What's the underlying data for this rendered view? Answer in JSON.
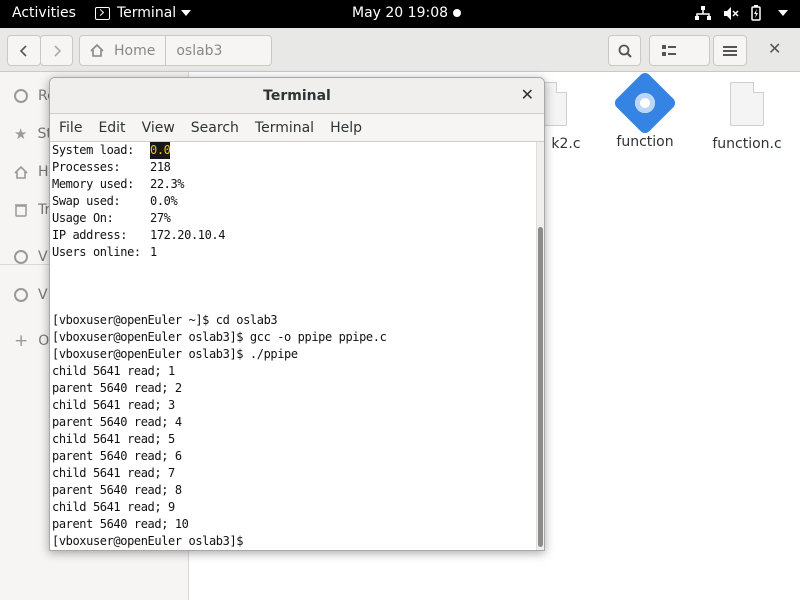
{
  "topbar": {
    "activities": "Activities",
    "app_name": "Terminal",
    "clock": "May 20  19:08"
  },
  "files": {
    "path": [
      "Home",
      "oslab3"
    ],
    "sidebar": [
      "Re",
      "St",
      "H",
      "Tr",
      "VI",
      "VI",
      "O"
    ],
    "items": [
      {
        "name": "k2.c",
        "icon": "document-icon"
      },
      {
        "name": "function",
        "icon": "executable-icon"
      },
      {
        "name": "function.c",
        "icon": "document-icon"
      }
    ]
  },
  "terminal": {
    "title": "Terminal",
    "menu": [
      "File",
      "Edit",
      "View",
      "Search",
      "Terminal",
      "Help"
    ],
    "sysinfo": [
      {
        "label": "System load:",
        "value": "0.0",
        "highlight": true
      },
      {
        "label": "Processes:",
        "value": "218"
      },
      {
        "label": "Memory used:",
        "value": "22.3%"
      },
      {
        "label": "Swap used:",
        "value": "0.0%"
      },
      {
        "label": "Usage On:",
        "value": "27%"
      },
      {
        "label": "IP address:",
        "value": "172.20.10.4"
      },
      {
        "label": "Users online:",
        "value": "1"
      }
    ],
    "lines": [
      "[vboxuser@openEuler ~]$ cd oslab3",
      "[vboxuser@openEuler oslab3]$ gcc -o ppipe ppipe.c",
      "[vboxuser@openEuler oslab3]$ ./ppipe",
      "child 5641 read; 1",
      "parent 5640 read; 2",
      "child 5641 read; 3",
      "parent 5640 read; 4",
      "child 5641 read; 5",
      "parent 5640 read; 6",
      "child 5641 read; 7",
      "parent 5640 read; 8",
      "child 5641 read; 9",
      "parent 5640 read; 10",
      "[vboxuser@openEuler oslab3]$"
    ]
  }
}
